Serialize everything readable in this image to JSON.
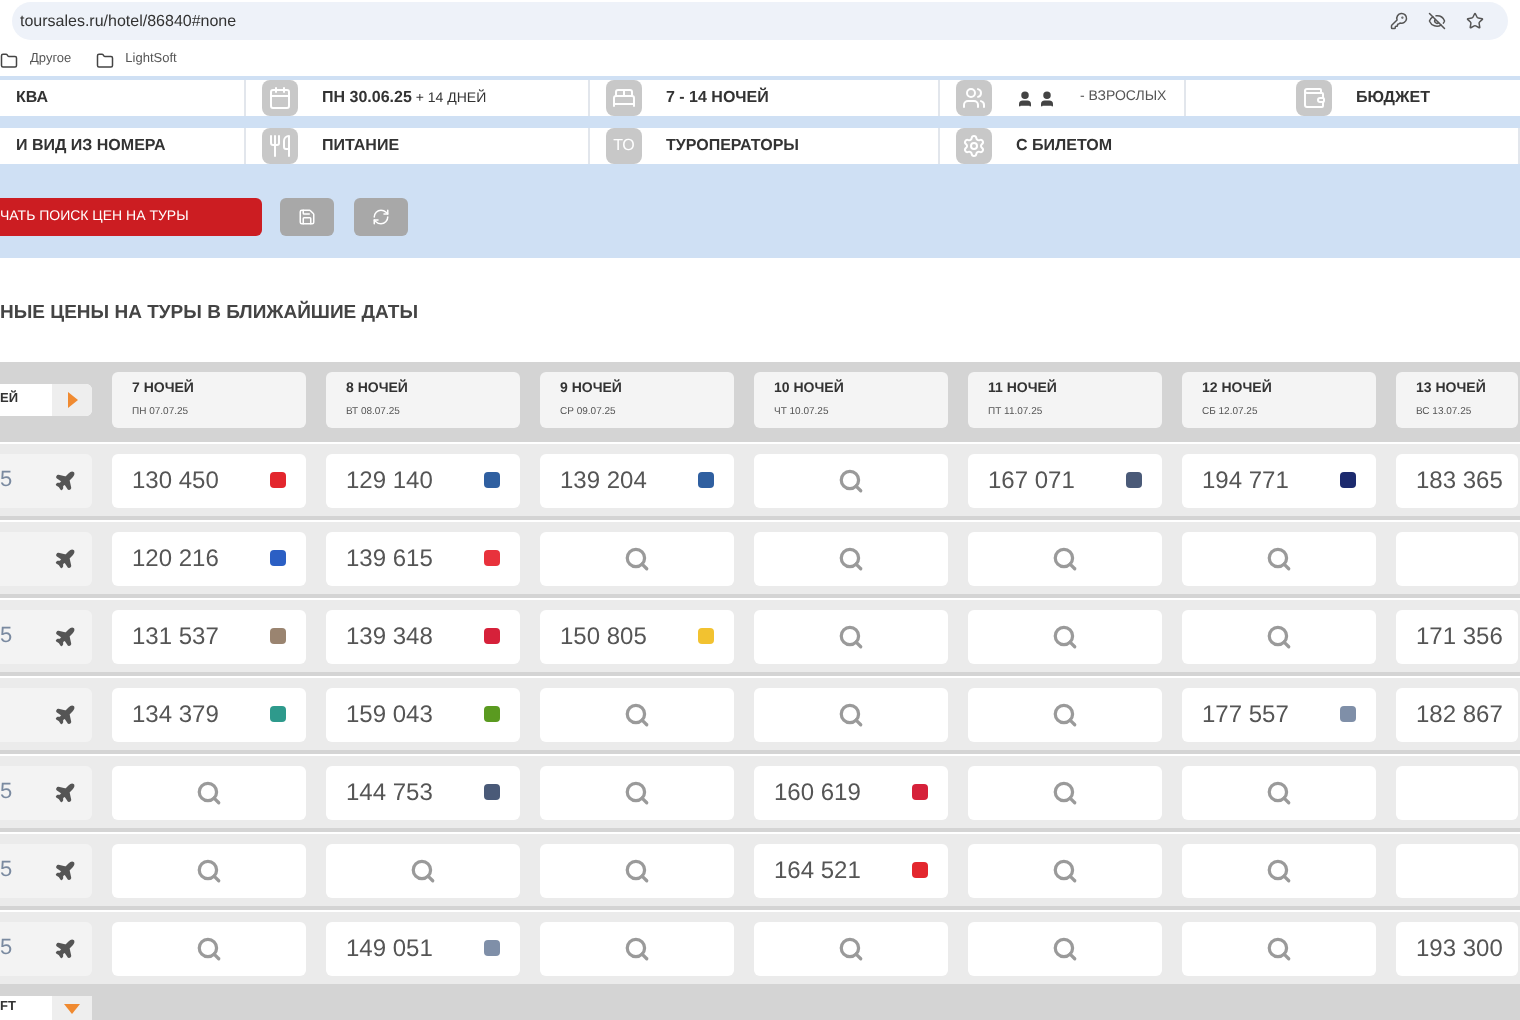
{
  "browser": {
    "url": "toursales.ru/hotel/86840#none",
    "bookmarks": [
      "Другое",
      "LightSoft"
    ]
  },
  "filters": [
    [
      {
        "kind": "text",
        "label": "КВА"
      },
      {
        "kind": "date",
        "label": "ПН 30.06.25",
        "extra": "+ 14 ДНЕЙ"
      },
      {
        "kind": "nights",
        "label": "7 - 14 НОЧЕЙ"
      },
      {
        "kind": "adults",
        "label": "- ВЗРОСЛЫХ"
      },
      {
        "kind": "budget",
        "label": "БЮДЖЕТ"
      }
    ],
    [
      {
        "kind": "text",
        "label": "И ВИД ИЗ НОМЕРА"
      },
      {
        "kind": "meal",
        "label": "ПИТАНИЕ"
      },
      {
        "kind": "operators",
        "badge": "ТО",
        "label": "ТУРОПЕРАТОРЫ"
      },
      {
        "kind": "ticket",
        "label": "С БИЛЕТОМ"
      }
    ]
  ],
  "actions": {
    "search_button": "ЧАТЬ ПОИСК ЦЕН НА ТУРЫ"
  },
  "section_title": "НЫЕ ЦЕНЫ НА ТУРЫ В БЛИЖАЙШИЕ ДАТЫ",
  "table": {
    "corner": "ЕЙ",
    "columns": [
      {
        "title": "7 НОЧЕЙ",
        "date": "ПН 07.07.25"
      },
      {
        "title": "8 НОЧЕЙ",
        "date": "ВТ 08.07.25"
      },
      {
        "title": "9 НОЧЕЙ",
        "date": "СР 09.07.25"
      },
      {
        "title": "10 НОЧЕЙ",
        "date": "ЧТ 10.07.25"
      },
      {
        "title": "11 НОЧЕЙ",
        "date": "ПТ 11.07.25"
      },
      {
        "title": "12 НОЧЕЙ",
        "date": "СБ 12.07.25"
      },
      {
        "title": "13 НОЧЕЙ",
        "date": "ВС 13.07.25"
      }
    ],
    "rows": [
      {
        "label": "5",
        "cells": [
          {
            "kind": "price",
            "price": "130 450",
            "color": "#e3262d"
          },
          {
            "kind": "price",
            "price": "129 140",
            "color": "#2f5fa0"
          },
          {
            "kind": "price",
            "price": "139 204",
            "color": "#2f5fa0"
          },
          {
            "kind": "search"
          },
          {
            "kind": "price",
            "price": "167 071",
            "color": "#4a5a78"
          },
          {
            "kind": "price",
            "price": "194 771",
            "color": "#1c2a6e"
          },
          {
            "kind": "price",
            "price": "183 365"
          }
        ]
      },
      {
        "cells": [
          {
            "kind": "price",
            "price": "120 216",
            "color": "#2b5fc4"
          },
          {
            "kind": "price",
            "price": "139 615",
            "color": "#e8323c"
          },
          {
            "kind": "search"
          },
          {
            "kind": "search"
          },
          {
            "kind": "search"
          },
          {
            "kind": "search"
          },
          {
            "kind": "empty"
          }
        ]
      },
      {
        "label": "5",
        "cells": [
          {
            "kind": "price",
            "price": "131 537",
            "color": "#9a8470"
          },
          {
            "kind": "price",
            "price": "139 348",
            "color": "#d6213a"
          },
          {
            "kind": "price",
            "price": "150 805",
            "color": "#f2c230"
          },
          {
            "kind": "search"
          },
          {
            "kind": "search"
          },
          {
            "kind": "search"
          },
          {
            "kind": "price",
            "price": "171 356"
          }
        ]
      },
      {
        "cells": [
          {
            "kind": "price",
            "price": "134 379",
            "color": "#2e9a8c"
          },
          {
            "kind": "price",
            "price": "159 043",
            "color": "#5a9a20"
          },
          {
            "kind": "search"
          },
          {
            "kind": "search"
          },
          {
            "kind": "search"
          },
          {
            "kind": "price",
            "price": "177 557",
            "color": "#7f8fa8"
          },
          {
            "kind": "price",
            "price": "182 867"
          }
        ]
      },
      {
        "label": "5",
        "cells": [
          {
            "kind": "search"
          },
          {
            "kind": "price",
            "price": "144 753",
            "color": "#4a5a78"
          },
          {
            "kind": "search"
          },
          {
            "kind": "price",
            "price": "160 619",
            "color": "#d6213a"
          },
          {
            "kind": "search"
          },
          {
            "kind": "search"
          },
          {
            "kind": "empty"
          }
        ]
      },
      {
        "label": "5",
        "cells": [
          {
            "kind": "search"
          },
          {
            "kind": "search"
          },
          {
            "kind": "search"
          },
          {
            "kind": "price",
            "price": "164 521",
            "color": "#e3262d"
          },
          {
            "kind": "search"
          },
          {
            "kind": "search"
          },
          {
            "kind": "empty"
          }
        ]
      },
      {
        "label": "5",
        "cells": [
          {
            "kind": "search"
          },
          {
            "kind": "price",
            "price": "149 051",
            "color": "#7f8fa8"
          },
          {
            "kind": "search"
          },
          {
            "kind": "search"
          },
          {
            "kind": "search"
          },
          {
            "kind": "search"
          },
          {
            "kind": "price",
            "price": "193 300"
          }
        ]
      }
    ],
    "footer_select": "FT"
  }
}
